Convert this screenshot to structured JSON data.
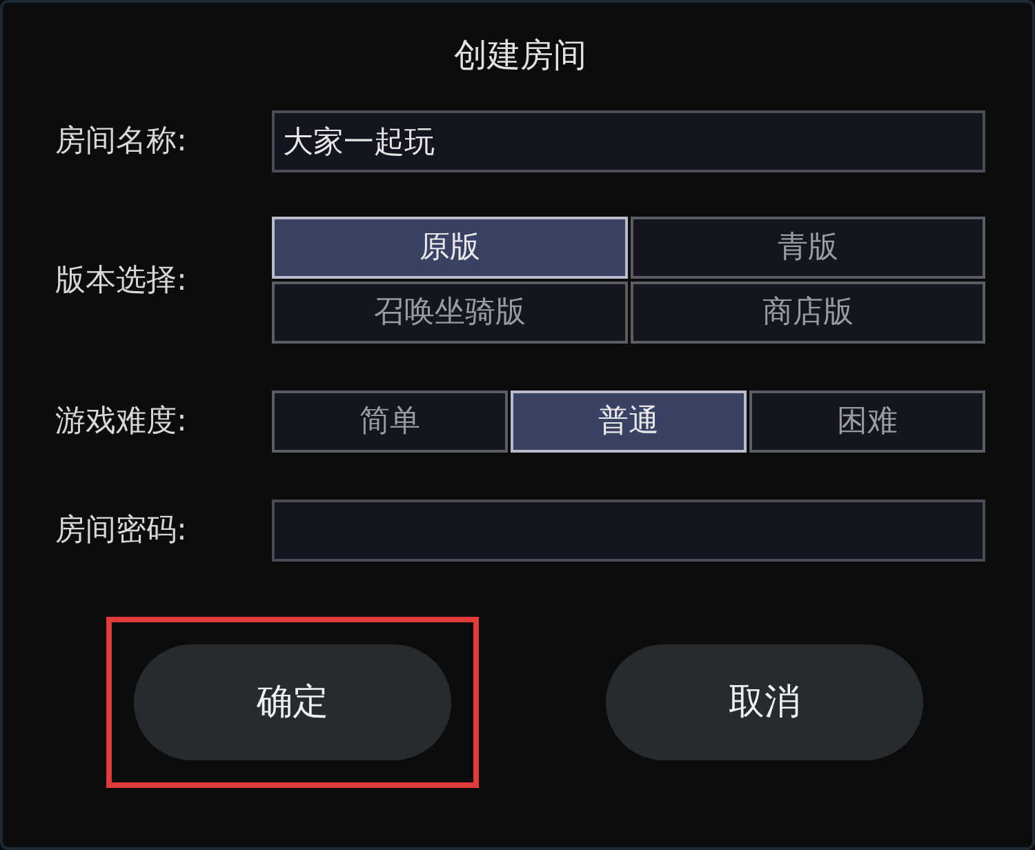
{
  "dialog": {
    "title": "创建房间"
  },
  "room_name": {
    "label": "房间名称:",
    "value": "大家一起玩"
  },
  "version": {
    "label": "版本选择:",
    "options": [
      {
        "label": "原版",
        "selected": true
      },
      {
        "label": "青版",
        "selected": false
      },
      {
        "label": "召唤坐骑版",
        "selected": false
      },
      {
        "label": "商店版",
        "selected": false
      }
    ]
  },
  "difficulty": {
    "label": "游戏难度:",
    "options": [
      {
        "label": "简单",
        "selected": false
      },
      {
        "label": "普通",
        "selected": true
      },
      {
        "label": "困难",
        "selected": false
      }
    ]
  },
  "password": {
    "label": "房间密码:"
  },
  "buttons": [
    {
      "label": "确定",
      "highlighted": true
    },
    {
      "label": "取消",
      "highlighted": false
    }
  ]
}
